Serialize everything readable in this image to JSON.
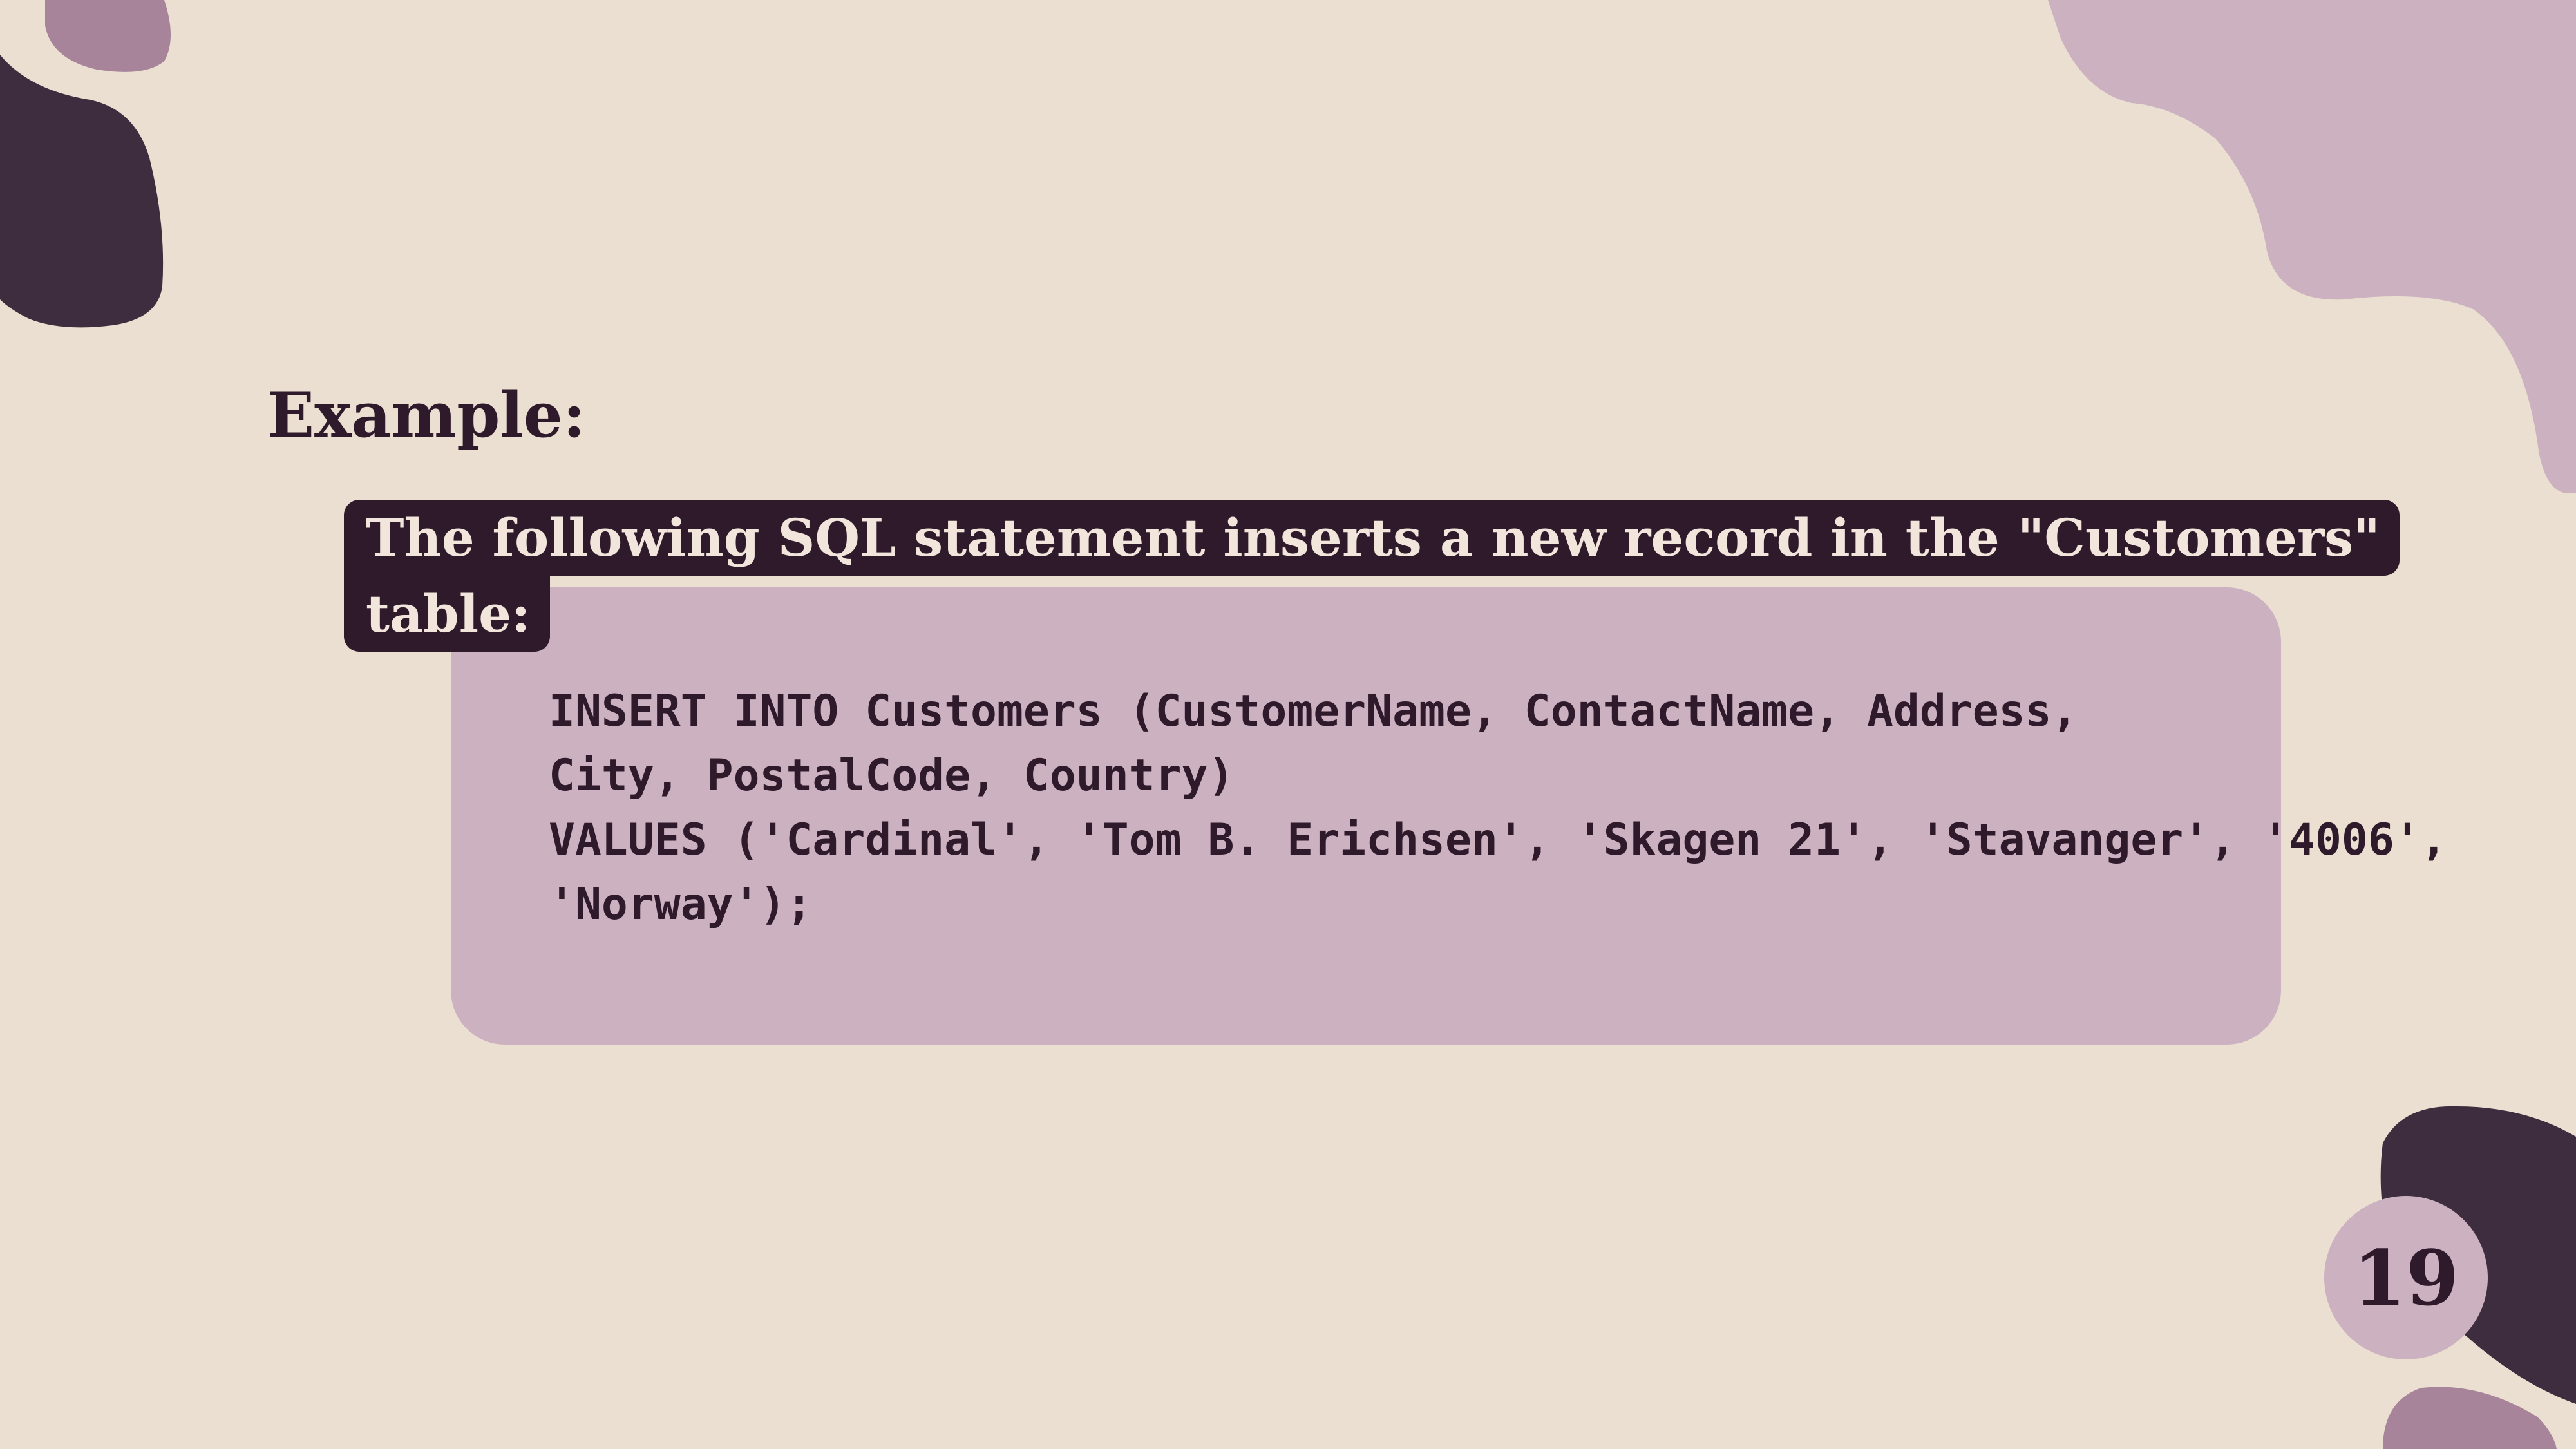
{
  "slide": {
    "heading": "Example:",
    "intro_lines": [
      "The following SQL statement inserts a new record in the \"Customers\"",
      "table:"
    ],
    "code_lines": [
      "INSERT INTO Customers (CustomerName, ContactName, Address,",
      "City, PostalCode, Country)",
      "VALUES ('Cardinal', 'Tom B. Erichsen', 'Skagen 21', 'Stavanger', '4006',",
      "'Norway');"
    ],
    "page_number": "19"
  },
  "colors": {
    "background": "#ebdfd2",
    "dark_plum": "#2f1a2b",
    "mauve": "#ccb2c1",
    "dusty_purple": "#a8849a",
    "blob_dark": "#3e2d3e"
  }
}
